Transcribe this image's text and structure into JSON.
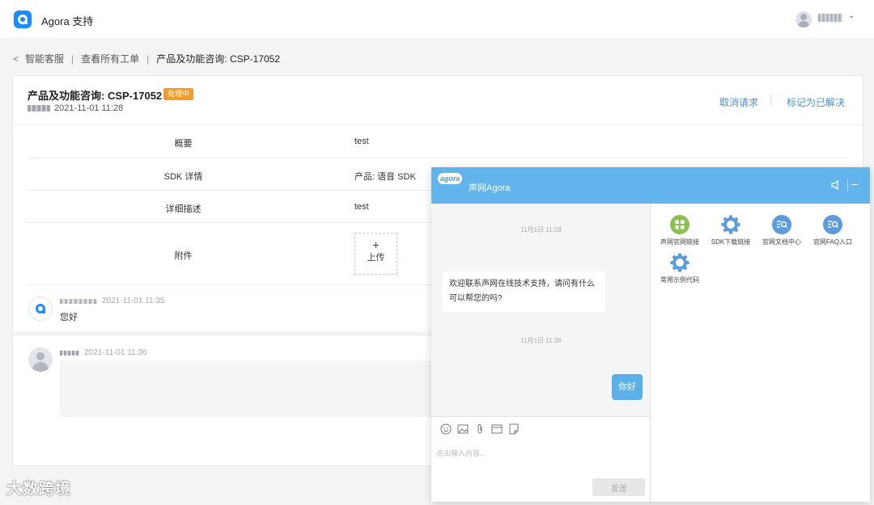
{
  "app": {
    "title": "Agora 支持"
  },
  "breadcrumb": {
    "items": [
      "智能客服",
      "查看所有工单",
      "产品及功能咨询: CSP-17052"
    ]
  },
  "ticket": {
    "title": "产品及功能咨询: CSP-17052",
    "status": "处理中",
    "created": "2021-11-01 11:28",
    "actions": {
      "cancel": "取消请求",
      "resolve": "标记为已解决"
    },
    "fields": [
      {
        "label": "概要",
        "value": "test"
      },
      {
        "label": "SDK 详情",
        "value": "产品: 语音 SDK"
      },
      {
        "label": "详细描述",
        "value": "test"
      },
      {
        "label": "附件",
        "upload_label": "上传"
      }
    ]
  },
  "comments": [
    {
      "time": "2021-11-01 11:35",
      "text": "您好"
    },
    {
      "time": "2021-11-01 11:36",
      "text": ""
    }
  ],
  "chat": {
    "logo": "agora",
    "title": "声网Agora",
    "messages": [
      {
        "type": "time",
        "text": "11月1日 11:28"
      },
      {
        "type": "in",
        "text": "欢迎联系声网在线技术支持，请问有什么可以帮您的吗?"
      },
      {
        "type": "time",
        "text": "11月1日 11:36"
      },
      {
        "type": "out",
        "text": "你好"
      }
    ],
    "input_placeholder": "点击输入内容...",
    "send_label": "发送",
    "links": [
      {
        "label": "声网官网链接",
        "icon": "grid-icon"
      },
      {
        "label": "SDK下载链接",
        "icon": "gear-icon"
      },
      {
        "label": "官网文档中心",
        "icon": "doc-search-icon"
      },
      {
        "label": "官网FAQ入口",
        "icon": "doc-search-icon"
      },
      {
        "label": "常用示例代码",
        "icon": "gear-icon"
      }
    ],
    "colors": {
      "header": "#62b4ec",
      "bubble_out": "#5dafe8",
      "link_green": "#8cc152",
      "link_blue": "#5b9be0"
    }
  },
  "status_color": "#f39c2b",
  "watermark": "大数跨境"
}
